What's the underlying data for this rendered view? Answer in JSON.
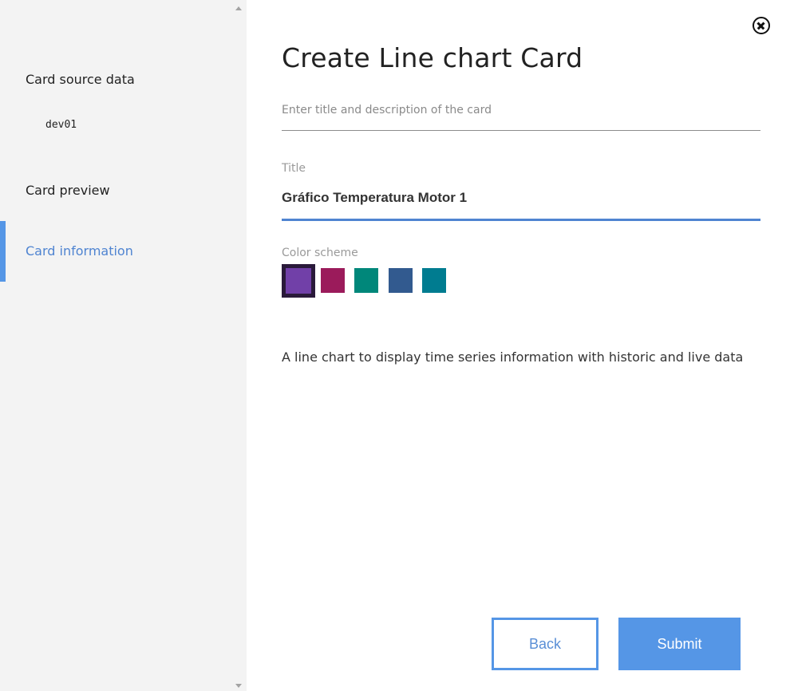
{
  "sidebar": {
    "items": [
      {
        "label": "Card source data"
      },
      {
        "label": "dev01"
      },
      {
        "label": "Card preview"
      },
      {
        "label": "Card information"
      }
    ]
  },
  "main": {
    "heading": "Create Line chart Card",
    "subtitle_placeholder": "Enter title and description of the card",
    "title_label": "Title",
    "title_value": "Gráfico Temperatura Motor 1",
    "color_scheme_label": "Color scheme",
    "color_swatches": [
      "#7140a8",
      "#9b1b5b",
      "#00877a",
      "#325a8f",
      "#007c90"
    ],
    "selected_swatch_index": 0,
    "description": "A line chart to display time series information with historic and live data"
  },
  "footer": {
    "back_label": "Back",
    "submit_label": "Submit"
  },
  "colors": {
    "accent": "#5596e6",
    "active_text": "#4f84d1",
    "sidebar_bg": "#f3f3f3"
  }
}
